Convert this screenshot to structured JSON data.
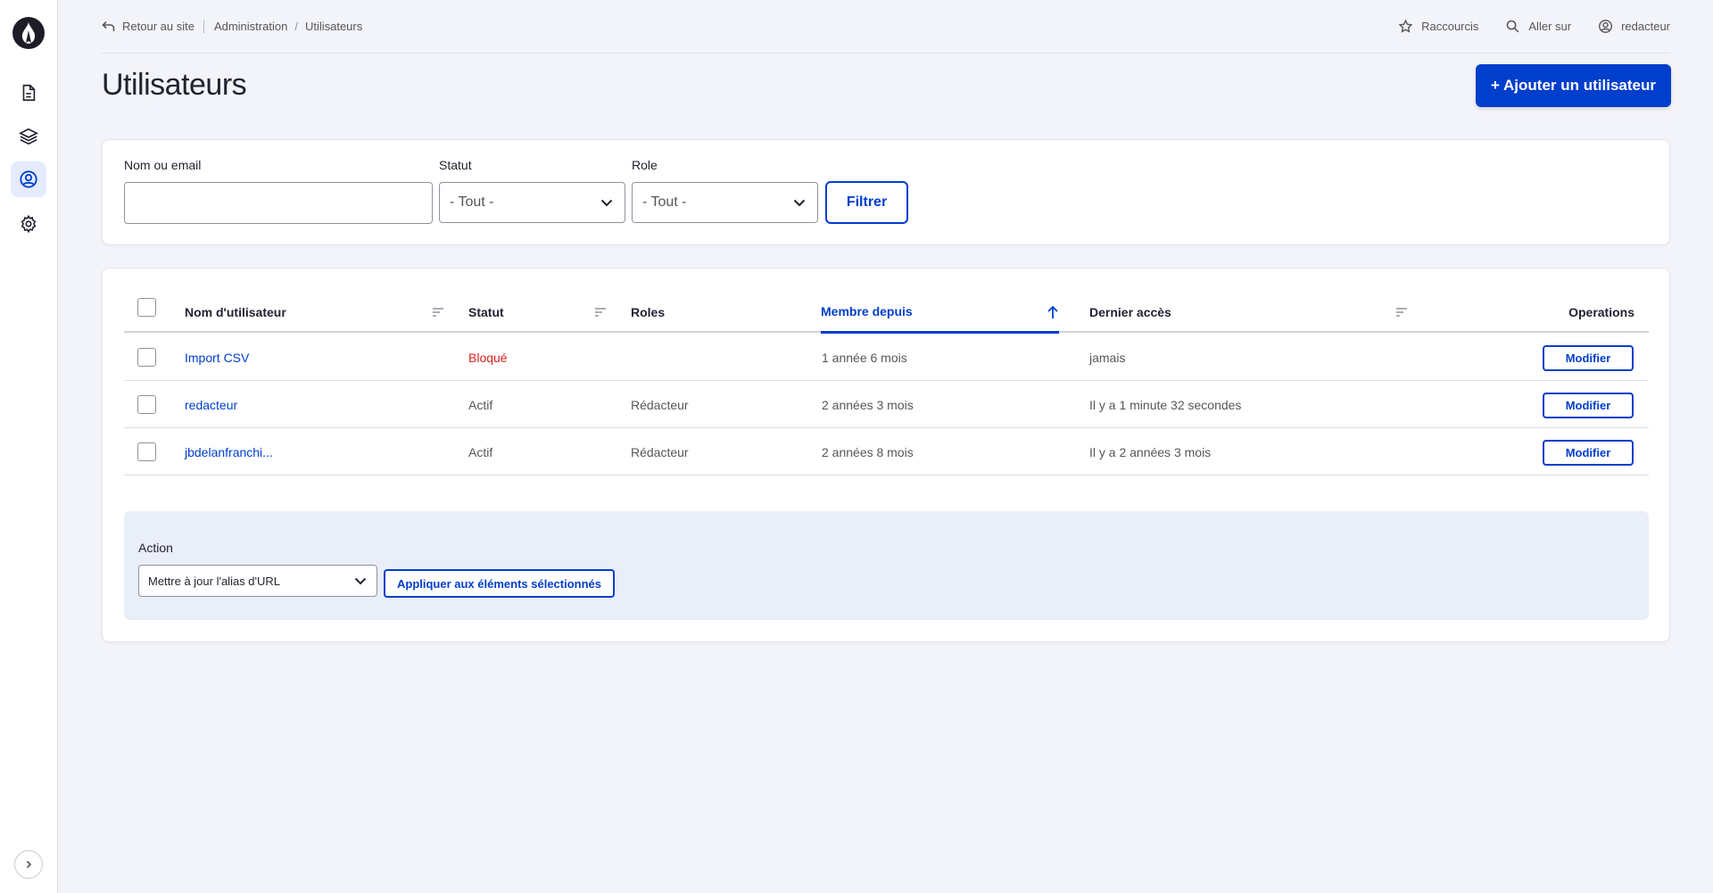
{
  "colors": {
    "accent": "#003ecc",
    "danger": "#dc2323",
    "text": "#222330",
    "muted": "#55565b"
  },
  "sidebar": {
    "logo_icon": "drupal-drop-icon",
    "items": [
      {
        "icon": "file-icon",
        "label": "Contenu",
        "active": false
      },
      {
        "icon": "layers-icon",
        "label": "Structure",
        "active": false
      },
      {
        "icon": "user-circle-icon",
        "label": "Utilisateurs",
        "active": true
      },
      {
        "icon": "gear-icon",
        "label": "Configuration",
        "active": false
      }
    ],
    "collapse_icon": "chevron-right-icon"
  },
  "topbar": {
    "back_label": "Retour au site",
    "breadcrumb": [
      "Administration",
      "Utilisateurs"
    ],
    "shortcuts_label": "Raccourcis",
    "goto_label": "Aller sur",
    "user_label": "redacteur"
  },
  "page": {
    "title": "Utilisateurs",
    "add_button": "+ Ajouter un utilisateur"
  },
  "filters": {
    "name_label": "Nom ou email",
    "name_value": "",
    "status_label": "Statut",
    "status_value": "- Tout -",
    "role_label": "Role",
    "role_value": "- Tout -",
    "filter_button": "Filtrer"
  },
  "table": {
    "headers": {
      "username": "Nom d'utilisateur",
      "status": "Statut",
      "roles": "Roles",
      "member_since": "Membre depuis",
      "last_access": "Dernier accès",
      "operations": "Operations"
    },
    "rows": [
      {
        "username": "Import CSV",
        "status": "Bloqué",
        "roles": "",
        "member_since": "1 année 6 mois",
        "last_access": "jamais",
        "op": "Modifier"
      },
      {
        "username": "redacteur",
        "status": "Actif",
        "roles": "Rédacteur",
        "member_since": "2 années 3 mois",
        "last_access": "Il y a 1 minute 32 secondes",
        "op": "Modifier"
      },
      {
        "username": "jbdelanfranchi...",
        "status": "Actif",
        "roles": "Rédacteur",
        "member_since": "2 années 8 mois",
        "last_access": "Il y a 2 années 3 mois",
        "op": "Modifier"
      }
    ]
  },
  "bulk": {
    "label": "Action",
    "select_value": "Mettre à jour l'alias d'URL",
    "apply_button": "Appliquer aux éléments sélectionnés"
  }
}
